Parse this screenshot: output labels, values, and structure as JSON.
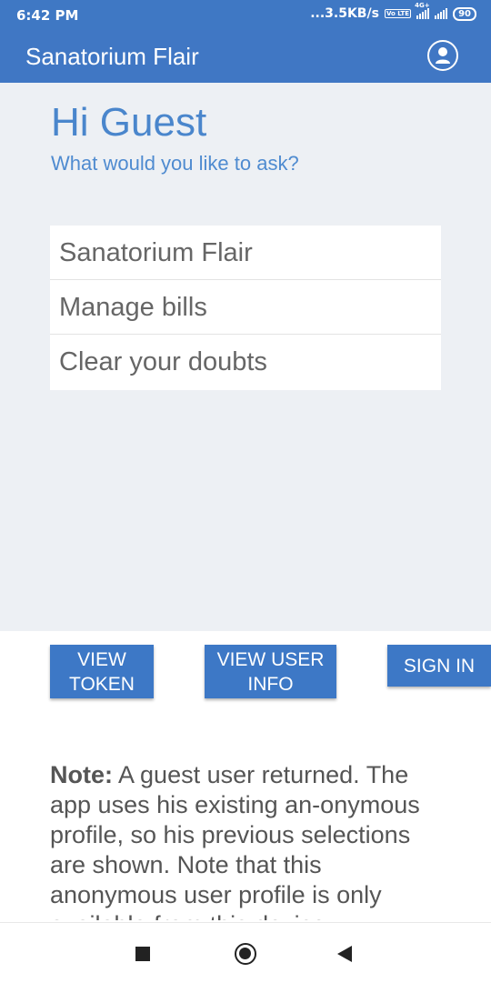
{
  "status_bar": {
    "time": "6:42 PM",
    "network_speed": "...3.5KB/s",
    "volte_label": "Vo LTE",
    "network_type": "4G+",
    "battery": "90"
  },
  "app_bar": {
    "title": "Sanatorium Flair",
    "account_icon": "account-circle-icon"
  },
  "main": {
    "greeting": "Hi Guest",
    "subtitle": "What would you like to ask?",
    "menu_items": [
      {
        "label": "Sanatorium Flair"
      },
      {
        "label": "Manage bills"
      },
      {
        "label": "Clear your doubts"
      }
    ]
  },
  "buttons": {
    "view_token": "VIEW\nTOKEN",
    "view_user_info": "VIEW USER\nINFO",
    "sign_in": "SIGN IN"
  },
  "note": {
    "label": "Note:",
    "text": " A guest user returned. The app uses his existing an-onymous profile, so his previous selections are shown. Note that this anonymous user profile is only available from this device."
  },
  "nav": {
    "recents_icon": "square-icon",
    "home_icon": "circle-icon",
    "back_icon": "triangle-back-icon"
  },
  "colors": {
    "primary": "#4077c4",
    "accent_text": "#4a86cc",
    "background": "#edf0f4"
  }
}
